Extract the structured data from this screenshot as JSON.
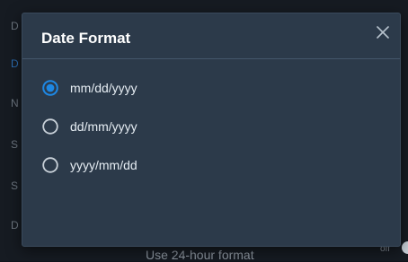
{
  "colors": {
    "accent": "#1e88e5",
    "dialog_bg": "#2c3a4a",
    "text": "#e6edf3"
  },
  "background": {
    "left_letters": [
      {
        "text": "D",
        "accent": false
      },
      {
        "text": "D",
        "accent": true
      },
      {
        "text": "N",
        "accent": false
      },
      {
        "text": "S",
        "accent": false
      },
      {
        "text": "S",
        "accent": false
      },
      {
        "text": "D",
        "accent": false
      }
    ],
    "bottom_label": "Use 24-hour format",
    "toggle_text": "off"
  },
  "dialog": {
    "title": "Date Format",
    "close_icon": "close-icon",
    "options": [
      {
        "label": "mm/dd/yyyy",
        "selected": true
      },
      {
        "label": "dd/mm/yyyy",
        "selected": false
      },
      {
        "label": "yyyy/mm/dd",
        "selected": false
      }
    ]
  }
}
